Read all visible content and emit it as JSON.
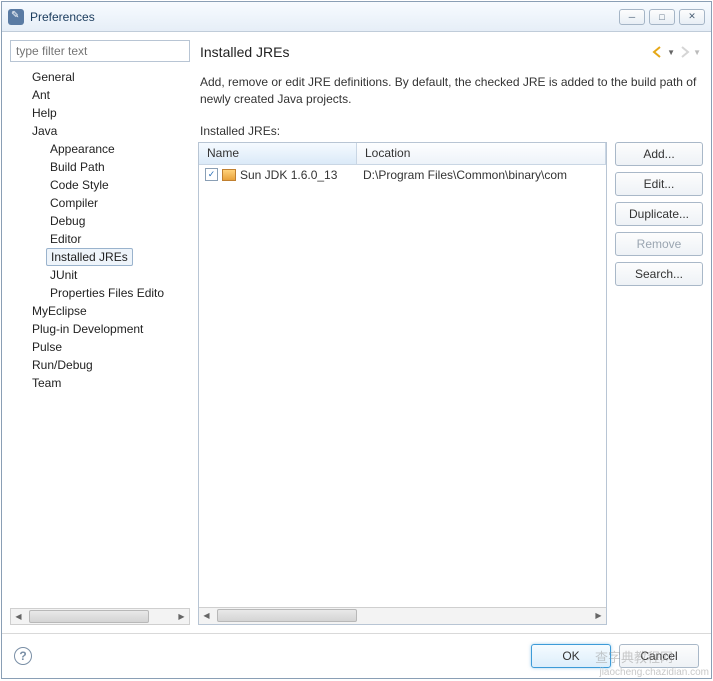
{
  "window": {
    "title": "Preferences"
  },
  "filter": {
    "placeholder": "type filter text"
  },
  "tree": {
    "items": [
      "General",
      "Ant",
      "Help",
      "Java",
      "Appearance",
      "Build Path",
      "Code Style",
      "Compiler",
      "Debug",
      "Editor",
      "Installed JREs",
      "JUnit",
      "Properties Files Edito",
      "MyEclipse",
      "Plug-in Development",
      "Pulse",
      "Run/Debug",
      "Team"
    ]
  },
  "page": {
    "title": "Installed JREs",
    "description": "Add, remove or edit JRE definitions. By default, the checked JRE is added to the build path of newly created Java projects.",
    "tableLabel": "Installed JREs:",
    "columns": {
      "name": "Name",
      "location": "Location"
    },
    "rows": [
      {
        "checked": true,
        "name": "Sun JDK 1.6.0_13",
        "location": "D:\\Program Files\\Common\\binary\\com"
      }
    ],
    "buttons": {
      "add": "Add...",
      "edit": "Edit...",
      "duplicate": "Duplicate...",
      "remove": "Remove",
      "search": "Search..."
    }
  },
  "footer": {
    "ok": "OK",
    "cancel": "Cancel"
  },
  "watermark": {
    "site": "jiaocheng.chazidian.com",
    "cn": "查字典教程网"
  }
}
